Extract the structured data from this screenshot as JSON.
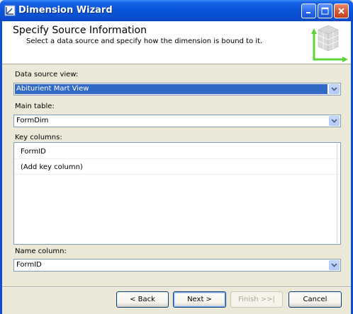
{
  "window": {
    "title": "Dimension Wizard",
    "icon": "wizard-icon"
  },
  "header": {
    "title": "Specify Source Information",
    "subtitle": "Select a data source and specify how the dimension is bound to it.",
    "graphic": "cube-axes-graphic"
  },
  "form": {
    "data_source_view": {
      "label": "Data source view:",
      "value": "Abiturient Mart View"
    },
    "main_table": {
      "label": "Main table:",
      "value": "FormDim"
    },
    "key_columns": {
      "label": "Key columns:",
      "items": [
        "FormID",
        "(Add key column)"
      ]
    },
    "name_column": {
      "label": "Name column:",
      "value": "FormID"
    }
  },
  "buttons": {
    "back": "< Back",
    "next": "Next >",
    "finish": "Finish >>|",
    "cancel": "Cancel"
  },
  "colors": {
    "titlebar": "#0a4fd6",
    "selection": "#316ac5",
    "dialog_bg": "#ece9d8"
  }
}
